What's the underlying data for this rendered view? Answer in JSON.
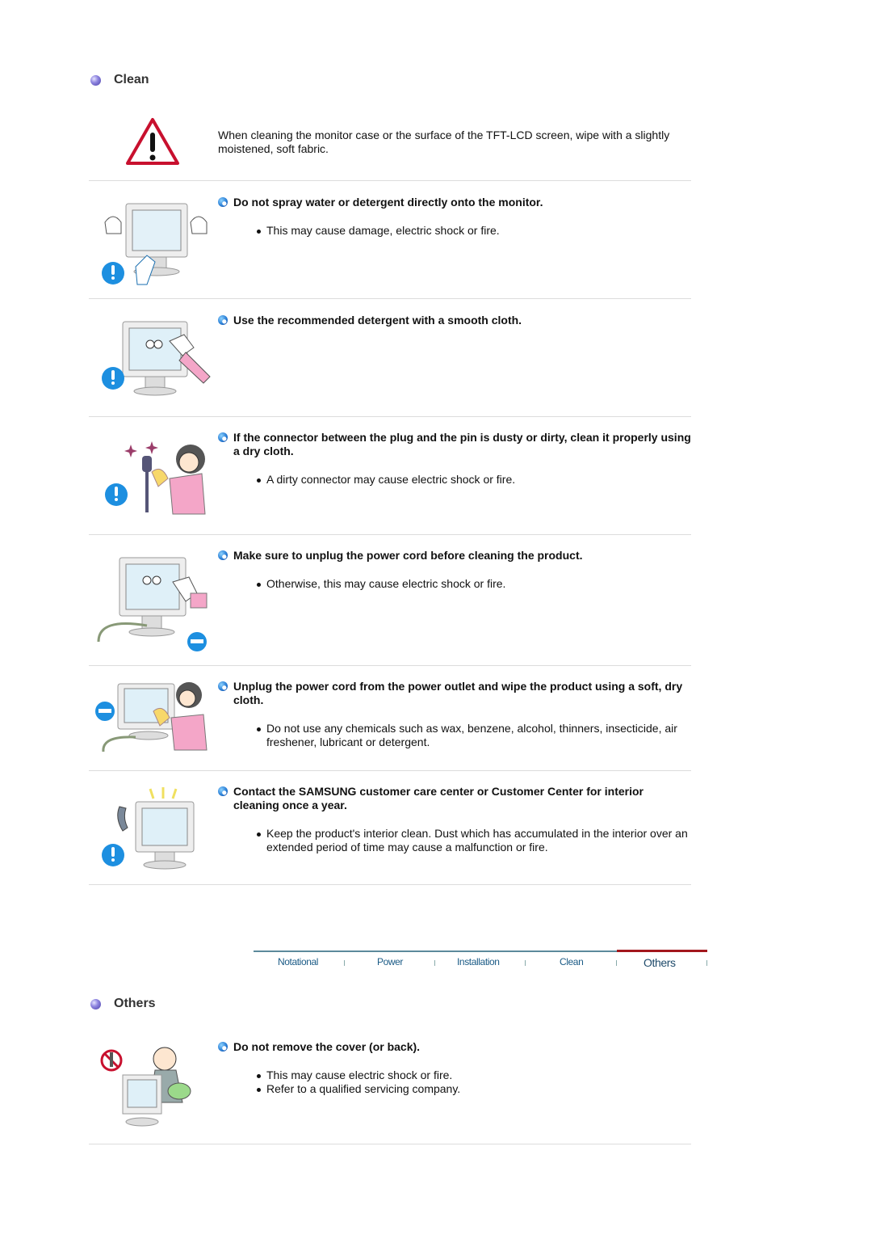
{
  "sections": {
    "clean": {
      "title": "Clean"
    },
    "others": {
      "title": "Others"
    }
  },
  "clean_intro": {
    "icon": "warning-triangle-icon",
    "text": "When cleaning the monitor case or the surface of the TFT-LCD screen, wipe with a slightly moistened, soft fabric."
  },
  "clean_items": [
    {
      "heading": "Do not spray water or detergent directly onto the monitor.",
      "bullets": [
        "This may cause damage, electric shock or fire."
      ],
      "illustration": "spray-monitor-illustration"
    },
    {
      "heading": "Use the recommended detergent with a smooth cloth.",
      "bullets": [],
      "illustration": "wipe-monitor-illustration"
    },
    {
      "heading": "If the connector between the plug and the pin is dusty or dirty, clean it properly using a dry cloth.",
      "bullets": [
        "A dirty connector may cause electric shock or fire."
      ],
      "illustration": "clean-plug-illustration"
    },
    {
      "heading": "Make sure to unplug the power cord before cleaning the product.",
      "bullets": [
        "Otherwise, this may cause electric shock or fire."
      ],
      "illustration": "unplug-before-cleaning-illustration"
    },
    {
      "heading": "Unplug the power cord from the power outlet and wipe the product using a soft, dry cloth.",
      "bullets": [
        "Do not use any chemicals such as wax, benzene, alcohol, thinners, insecticide, air freshener, lubricant or detergent."
      ],
      "illustration": "wipe-dry-cloth-illustration"
    },
    {
      "heading": "Contact the SAMSUNG customer care center or Customer Center for interior cleaning once a year.",
      "bullets": [
        "Keep the product's interior clean. Dust which has accumulated in the interior over an extended period of time may cause a malfunction or fire."
      ],
      "illustration": "call-service-illustration"
    }
  ],
  "nav": {
    "items": [
      {
        "label": "Notational",
        "active": false
      },
      {
        "label": "Power",
        "active": false
      },
      {
        "label": "Installation",
        "active": false
      },
      {
        "label": "Clean",
        "active": false
      },
      {
        "label": "Others",
        "active": true
      }
    ],
    "active_color": "#a3171d",
    "line_color": "#5c8a9b"
  },
  "others_items": [
    {
      "heading": "Do not remove the cover (or back).",
      "bullets": [
        "This may cause electric shock or fire.",
        "Refer to a qualified servicing company."
      ],
      "illustration": "no-disassembly-illustration"
    }
  ]
}
